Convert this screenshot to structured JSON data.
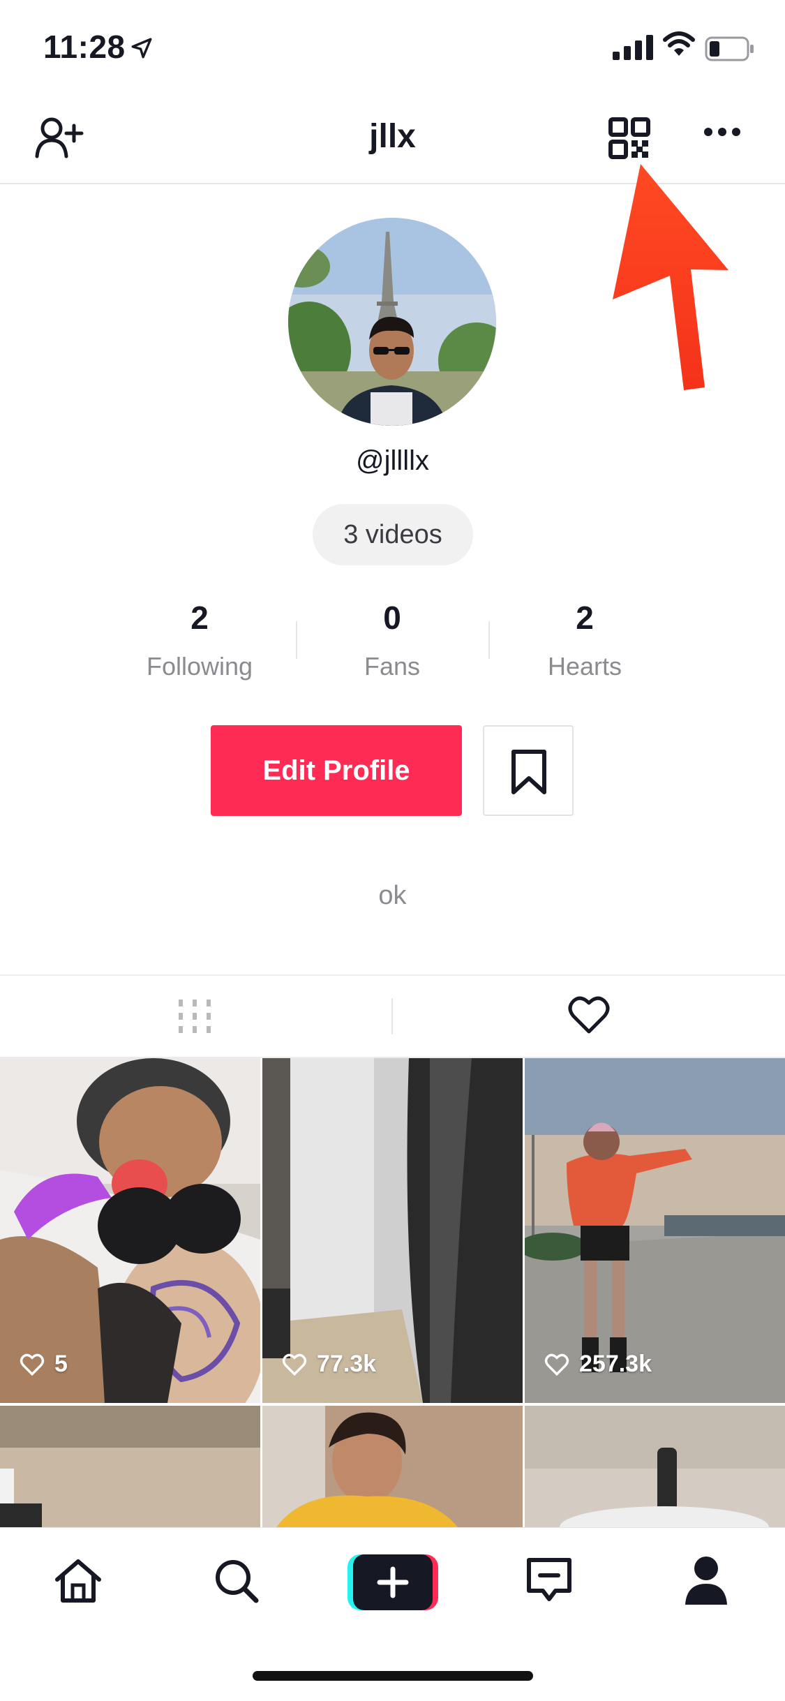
{
  "status_bar": {
    "time": "11:28"
  },
  "header": {
    "title": "jllx"
  },
  "profile": {
    "username": "@jllllx",
    "videos_label": "3 videos",
    "bio": "ok"
  },
  "stats": [
    {
      "value": "2",
      "label": "Following"
    },
    {
      "value": "0",
      "label": "Fans"
    },
    {
      "value": "2",
      "label": "Hearts"
    }
  ],
  "actions": {
    "edit_profile": "Edit Profile"
  },
  "videos": [
    {
      "likes": "5"
    },
    {
      "likes": "77.3k"
    },
    {
      "likes": "257.3k"
    }
  ],
  "colors": {
    "accent": "#fe2c55",
    "annotation_arrow": "#fe3a1f"
  },
  "icons": [
    "navigation-arrow-icon",
    "signal-icon",
    "wifi-icon",
    "battery-icon",
    "add-user-icon",
    "qr-code-icon",
    "more-icon",
    "bookmark-icon",
    "grid-icon",
    "heart-icon",
    "home-icon",
    "search-icon",
    "create-icon",
    "inbox-icon",
    "profile-icon"
  ]
}
